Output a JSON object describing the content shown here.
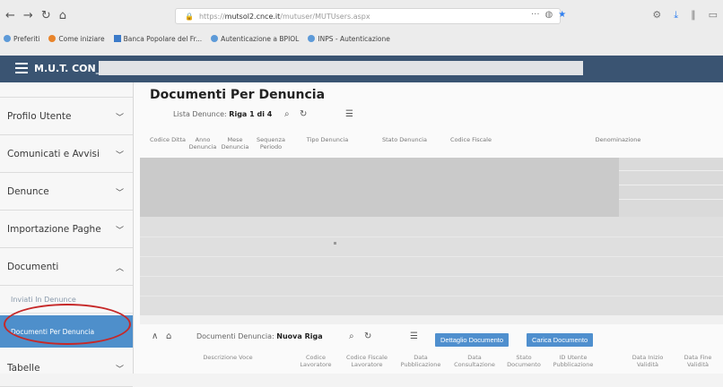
{
  "browser": {
    "url": "https://mutsol2.cnce.it/mutuser/MUTUsers.aspx",
    "url_prefix": "https://",
    "url_domain": "mutsol2.cnce.it",
    "url_path": "/mutuser/MUTUsers.aspx",
    "bookmarks": [
      "Preferiti",
      "Come iniziare",
      "Banca Popolare del Fr...",
      "Autenticazione a BPIOL",
      "INPS - Autenticazione"
    ]
  },
  "app": {
    "title": "M.U.T. CON_"
  },
  "sidebar": {
    "items": [
      {
        "label": "Profilo Utente"
      },
      {
        "label": "Comunicati e Avvisi"
      },
      {
        "label": "Denunce"
      },
      {
        "label": "Importazione Paghe"
      },
      {
        "label": "Documenti"
      }
    ],
    "sub_items": [
      "Inviati In Denunce",
      "Documenti Per Denuncia"
    ],
    "tabelle": "Tabelle"
  },
  "main": {
    "page_title": "Documenti Per Denuncia",
    "list_label": "Lista Denunce:",
    "list_value": "Riga 1 di 4",
    "columns": [
      "Codice Ditta",
      "Anno Denuncia",
      "Mese Denuncia",
      "Sequenza Periodo",
      "Tipo Denuncia",
      "Stato Denuncia",
      "Codice Fiscale",
      "Denominazione"
    ],
    "docs_label": "Documenti Denuncia:",
    "docs_value": "Nuova Riga",
    "buttons": {
      "dettaglio": "Dettaglio Documento",
      "carica": "Carica Documento"
    },
    "doc_columns": [
      "Descrizione Voce",
      "Codice Lavoratore",
      "Codice Fiscale Lavoratore",
      "Data Pubblicazione",
      "Data Consultazione",
      "Stato Documento",
      "ID Utente Pubblicazione",
      "Data Inizio Validità",
      "Data Fine Validità"
    ]
  }
}
